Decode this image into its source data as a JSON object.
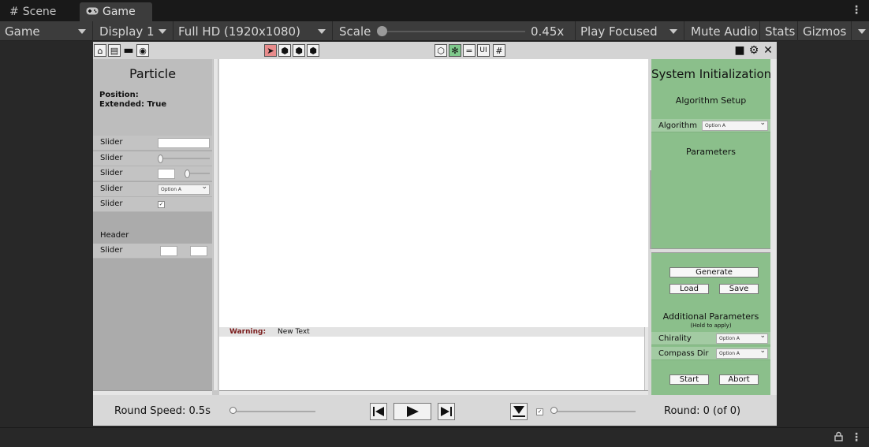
{
  "tabs": [
    {
      "label": "Scene",
      "icon": "grid-icon"
    },
    {
      "label": "Game",
      "icon": "gamepad-icon"
    }
  ],
  "toolbar": {
    "view_select": "Game",
    "display": "Display 1",
    "resolution": "Full HD (1920x1080)",
    "scale_label": "Scale",
    "scale_value": "0.45x",
    "scale_fraction": 0.0,
    "play_mode": "Play Focused",
    "mute": "Mute Audio",
    "stats": "Stats",
    "gizmos": "Gizmos"
  },
  "game": {
    "toolbar_icons": [
      "home-icon",
      "save-icon",
      "folder-icon",
      "camera-icon",
      "pointer-tool-icon",
      "add-particle-icon",
      "remove-particle-icon",
      "rotate-particle-icon",
      "hexagon-icon",
      "hexagon-grid-icon",
      "equals-icon",
      "ui-toggle-icon",
      "hash-grid-icon",
      "video-camera-icon",
      "settings-icon",
      "close-icon"
    ],
    "left_panel": {
      "title": "Particle",
      "position_label": "Position:",
      "extended_label": "Extended: True",
      "rows": [
        {
          "label": "Slider",
          "control": "text"
        },
        {
          "label": "Slider",
          "control": "slider"
        },
        {
          "label": "Slider",
          "control": "text-slider"
        },
        {
          "label": "Slider",
          "control": "dropdown",
          "value": "Option A"
        },
        {
          "label": "Slider",
          "control": "checkbox"
        }
      ],
      "header": "Header",
      "last_row": {
        "label": "Slider",
        "control": "two-fields"
      }
    },
    "warning": {
      "label": "Warning:",
      "text": "New Text"
    },
    "right_panel": {
      "title": "System Initialization",
      "algorithm_setup": "Algorithm Setup",
      "algorithm_label": "Algorithm",
      "algorithm_value": "Option A",
      "parameters": "Parameters",
      "generate": "Generate",
      "load": "Load",
      "save": "Save",
      "additional": "Additional Parameters",
      "hold": "(Hold to apply)",
      "chirality_label": "Chirality",
      "chirality_value": "Option A",
      "compass_label": "Compass Dir",
      "compass_value": "Option A",
      "start": "Start",
      "abort": "Abort"
    },
    "bottom": {
      "round_speed": "Round Speed: 0.5s",
      "round": "Round: 0 (of 0)"
    }
  }
}
